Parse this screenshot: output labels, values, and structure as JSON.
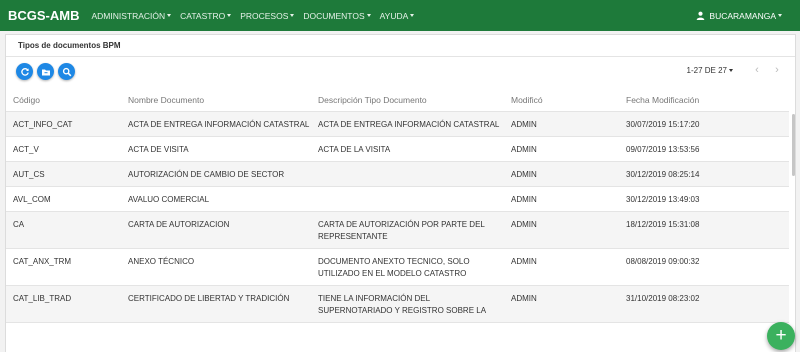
{
  "app": {
    "brand": "BCGS-AMB"
  },
  "nav": {
    "items": [
      {
        "label": "ADMINISTRACIÓN"
      },
      {
        "label": "CATASTRO"
      },
      {
        "label": "PROCESOS"
      },
      {
        "label": "DOCUMENTOS"
      },
      {
        "label": "AYUDA"
      }
    ],
    "user": "BUCARAMANGA"
  },
  "card": {
    "title": "Tipos de documentos BPM"
  },
  "toolbar": {
    "icons": [
      "refresh-icon",
      "folder-icon",
      "search-icon"
    ]
  },
  "pager": {
    "label": "1-27 DE 27",
    "prev": "‹",
    "next": "›"
  },
  "table": {
    "headers": [
      "Código",
      "Nombre Documento",
      "Descripción Tipo Documento",
      "Modificó",
      "Fecha Modificación"
    ],
    "rows": [
      {
        "codigo": "ACT_INFO_CAT",
        "nombre": "ACTA DE ENTREGA INFORMACIÓN CATASTRAL",
        "descripcion": "ACTA DE ENTREGA INFORMACIÓN CATASTRAL",
        "modifico": "ADMIN",
        "fecha": "30/07/2019 15:17:20"
      },
      {
        "codigo": "ACT_V",
        "nombre": "ACTA DE VISITA",
        "descripcion": "ACTA DE LA VISITA",
        "modifico": "ADMIN",
        "fecha": "09/07/2019 13:53:56"
      },
      {
        "codigo": "AUT_CS",
        "nombre": "AUTORIZACIÓN DE CAMBIO DE SECTOR",
        "descripcion": "",
        "modifico": "ADMIN",
        "fecha": "30/12/2019 08:25:14"
      },
      {
        "codigo": "AVL_COM",
        "nombre": "AVALUO COMERCIAL",
        "descripcion": "",
        "modifico": "ADMIN",
        "fecha": "30/12/2019 13:49:03"
      },
      {
        "codigo": "CA",
        "nombre": "CARTA DE AUTORIZACION",
        "descripcion": "CARTA DE AUTORIZACIÓN POR PARTE DEL REPRESENTANTE",
        "modifico": "ADMIN",
        "fecha": "18/12/2019 15:31:08"
      },
      {
        "codigo": "CAT_ANX_TRM",
        "nombre": "ANEXO TÉCNICO",
        "descripcion": "DOCUMENTO ANEXTO TECNICO, SOLO UTILIZADO EN EL MODELO CATASTRO",
        "modifico": "ADMIN",
        "fecha": "08/08/2019 09:00:32"
      },
      {
        "codigo": "CAT_LIB_TRAD",
        "nombre": "CERTIFICADO DE LIBERTAD Y TRADICIÓN",
        "descripcion": "TIENE LA INFORMACIÓN DEL SUPERNOTARIADO Y REGISTRO SOBRE LA",
        "modifico": "ADMIN",
        "fecha": "31/10/2019 08:23:02"
      }
    ]
  },
  "fab": {
    "label": "+"
  },
  "colors": {
    "navbar": "#1e7a3a",
    "toolbar_button": "#1e88e5",
    "fab": "#3bb15e"
  }
}
